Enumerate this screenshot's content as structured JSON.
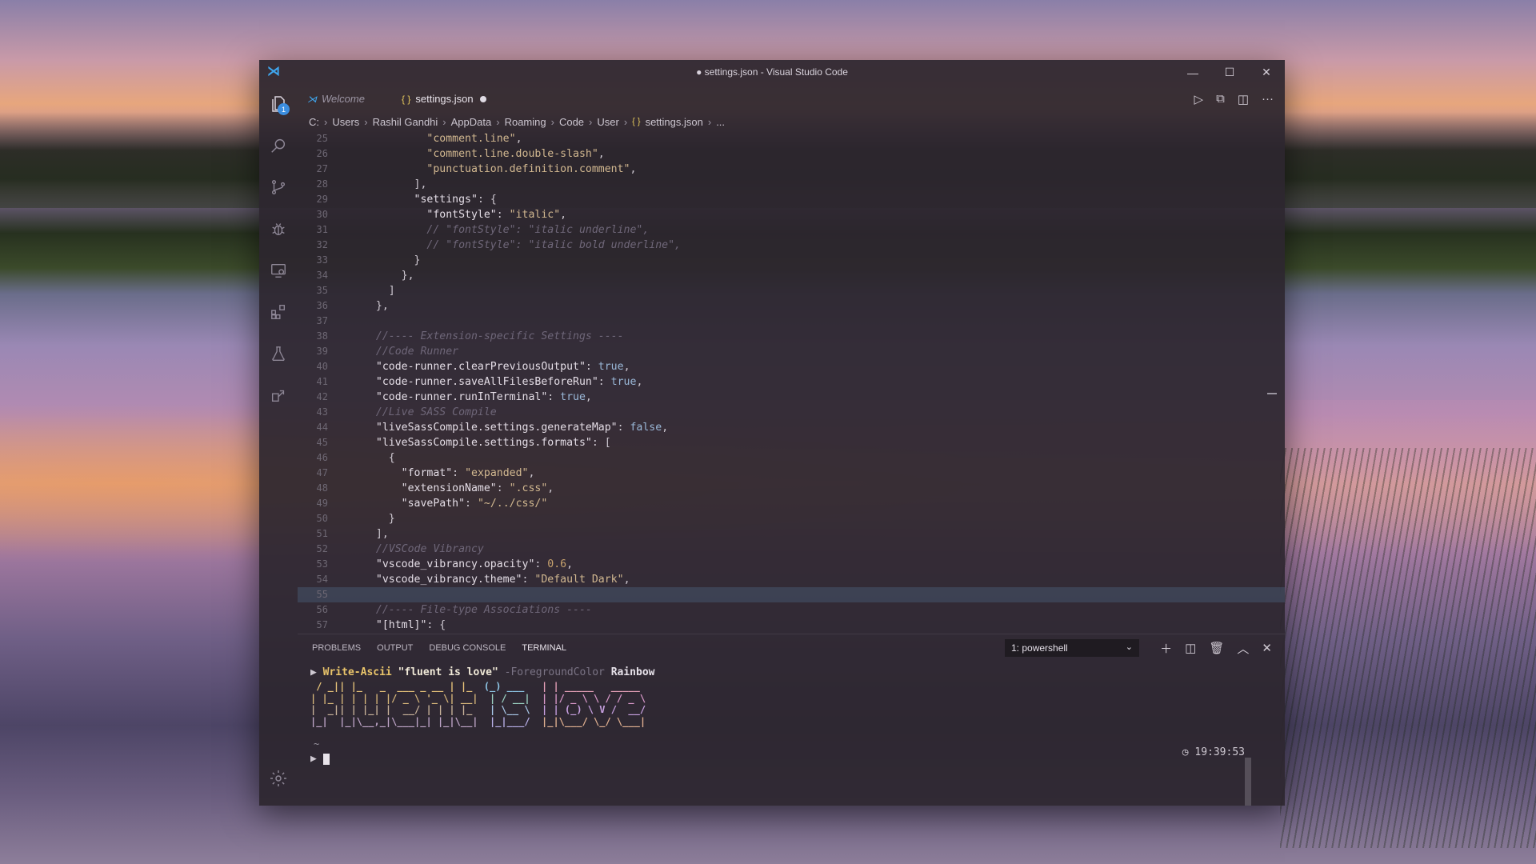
{
  "window": {
    "title": "● settings.json - Visual Studio Code",
    "controls": {
      "minimize": "—",
      "maximize": "☐",
      "close": "✕"
    }
  },
  "activity_bar": {
    "explorer_badge": "1",
    "icons": [
      "files-icon",
      "search-icon",
      "source-control-icon",
      "debug-icon",
      "remote-explorer-icon",
      "extensions-icon",
      "testing-icon",
      "live-share-icon",
      "settings-gear-icon"
    ]
  },
  "tabs": [
    {
      "label": "Welcome",
      "icon": "vscode-icon"
    },
    {
      "label": "settings.json",
      "icon": "{ }",
      "modified": true
    }
  ],
  "breadcrumb": [
    "C:",
    "Users",
    "Rashil Gandhi",
    "AppData",
    "Roaming",
    "Code",
    "User",
    "settings.json",
    "..."
  ],
  "editor": {
    "lines": [
      {
        "n": "25",
        "html": "          <span class='s'>\"comment.line\"</span><span class='p'>,</span>"
      },
      {
        "n": "26",
        "html": "          <span class='s'>\"comment.line.double-slash\"</span><span class='p'>,</span>"
      },
      {
        "n": "27",
        "html": "          <span class='s'>\"punctuation.definition.comment\"</span><span class='p'>,</span>"
      },
      {
        "n": "28",
        "html": "        <span class='p'>],</span>"
      },
      {
        "n": "29",
        "html": "        <span class='k'>\"settings\"</span><span class='p'>: {</span>"
      },
      {
        "n": "30",
        "html": "          <span class='k'>\"fontStyle\"</span><span class='p'>: </span><span class='s'>\"italic\"</span><span class='p'>,</span>"
      },
      {
        "n": "31",
        "html": "          <span class='c'>// \"fontStyle\": \"italic underline\",</span>"
      },
      {
        "n": "32",
        "html": "          <span class='c'>// \"fontStyle\": \"italic bold underline\",</span>"
      },
      {
        "n": "33",
        "html": "        <span class='p'>}</span>"
      },
      {
        "n": "34",
        "html": "      <span class='p'>},</span>"
      },
      {
        "n": "35",
        "html": "    <span class='p'>]</span>"
      },
      {
        "n": "36",
        "html": "  <span class='p'>},</span>"
      },
      {
        "n": "37",
        "html": ""
      },
      {
        "n": "38",
        "html": "  <span class='c'>//---- Extension-specific Settings ----</span>"
      },
      {
        "n": "39",
        "html": "  <span class='c'>//Code Runner</span>"
      },
      {
        "n": "40",
        "html": "  <span class='k'>\"code-runner.clearPreviousOutput\"</span><span class='p'>: </span><span class='b'>true</span><span class='p'>,</span>"
      },
      {
        "n": "41",
        "html": "  <span class='k'>\"code-runner.saveAllFilesBeforeRun\"</span><span class='p'>: </span><span class='b'>true</span><span class='p'>,</span>"
      },
      {
        "n": "42",
        "html": "  <span class='k'>\"code-runner.runInTerminal\"</span><span class='p'>: </span><span class='b'>true</span><span class='p'>,</span>"
      },
      {
        "n": "43",
        "html": "  <span class='c'>//Live SASS Compile</span>"
      },
      {
        "n": "44",
        "html": "  <span class='k'>\"liveSassCompile.settings.generateMap\"</span><span class='p'>: </span><span class='b'>false</span><span class='p'>,</span>"
      },
      {
        "n": "45",
        "html": "  <span class='k'>\"liveSassCompile.settings.formats\"</span><span class='p'>: [</span>"
      },
      {
        "n": "46",
        "html": "    <span class='p'>{</span>"
      },
      {
        "n": "47",
        "html": "      <span class='k'>\"format\"</span><span class='p'>: </span><span class='s'>\"expanded\"</span><span class='p'>,</span>"
      },
      {
        "n": "48",
        "html": "      <span class='k'>\"extensionName\"</span><span class='p'>: </span><span class='s'>\".css\"</span><span class='p'>,</span>"
      },
      {
        "n": "49",
        "html": "      <span class='k'>\"savePath\"</span><span class='p'>: </span><span class='s'>\"~/../css/\"</span>"
      },
      {
        "n": "50",
        "html": "    <span class='p'>}</span>"
      },
      {
        "n": "51",
        "html": "  <span class='p'>],</span>"
      },
      {
        "n": "52",
        "html": "  <span class='c'>//VSCode Vibrancy</span>"
      },
      {
        "n": "53",
        "html": "  <span class='k'>\"vscode_vibrancy.opacity\"</span><span class='p'>: </span><span class='n'>0.6</span><span class='p'>,</span>"
      },
      {
        "n": "54",
        "html": "  <span class='k'>\"vscode_vibrancy.theme\"</span><span class='p'>: </span><span class='s'>\"Default Dark\"</span><span class='p'>,</span>"
      },
      {
        "n": "55",
        "html": "",
        "current": true
      },
      {
        "n": "56",
        "html": "  <span class='c'>//---- File-type Associations ----</span>"
      },
      {
        "n": "57",
        "html": "  <span class='k'>\"[html]\"</span><span class='p'>: {</span>"
      }
    ]
  },
  "panel": {
    "tabs": [
      "PROBLEMS",
      "OUTPUT",
      "DEBUG CONSOLE",
      "TERMINAL"
    ],
    "active_tab": "TERMINAL",
    "terminal_select": "1: powershell",
    "terminal": {
      "prompt": "▶",
      "command": "Write-Ascii",
      "arg": "\"fluent is love\"",
      "flag": "-ForegroundColor",
      "flag_value": "Rainbow",
      "time": "◷ 19:39:53",
      "tilde": "~"
    }
  },
  "colors": {
    "accent": "#3c8ee0",
    "current_line": "#4f6e8c",
    "terminal_command": "#e9c46a"
  }
}
